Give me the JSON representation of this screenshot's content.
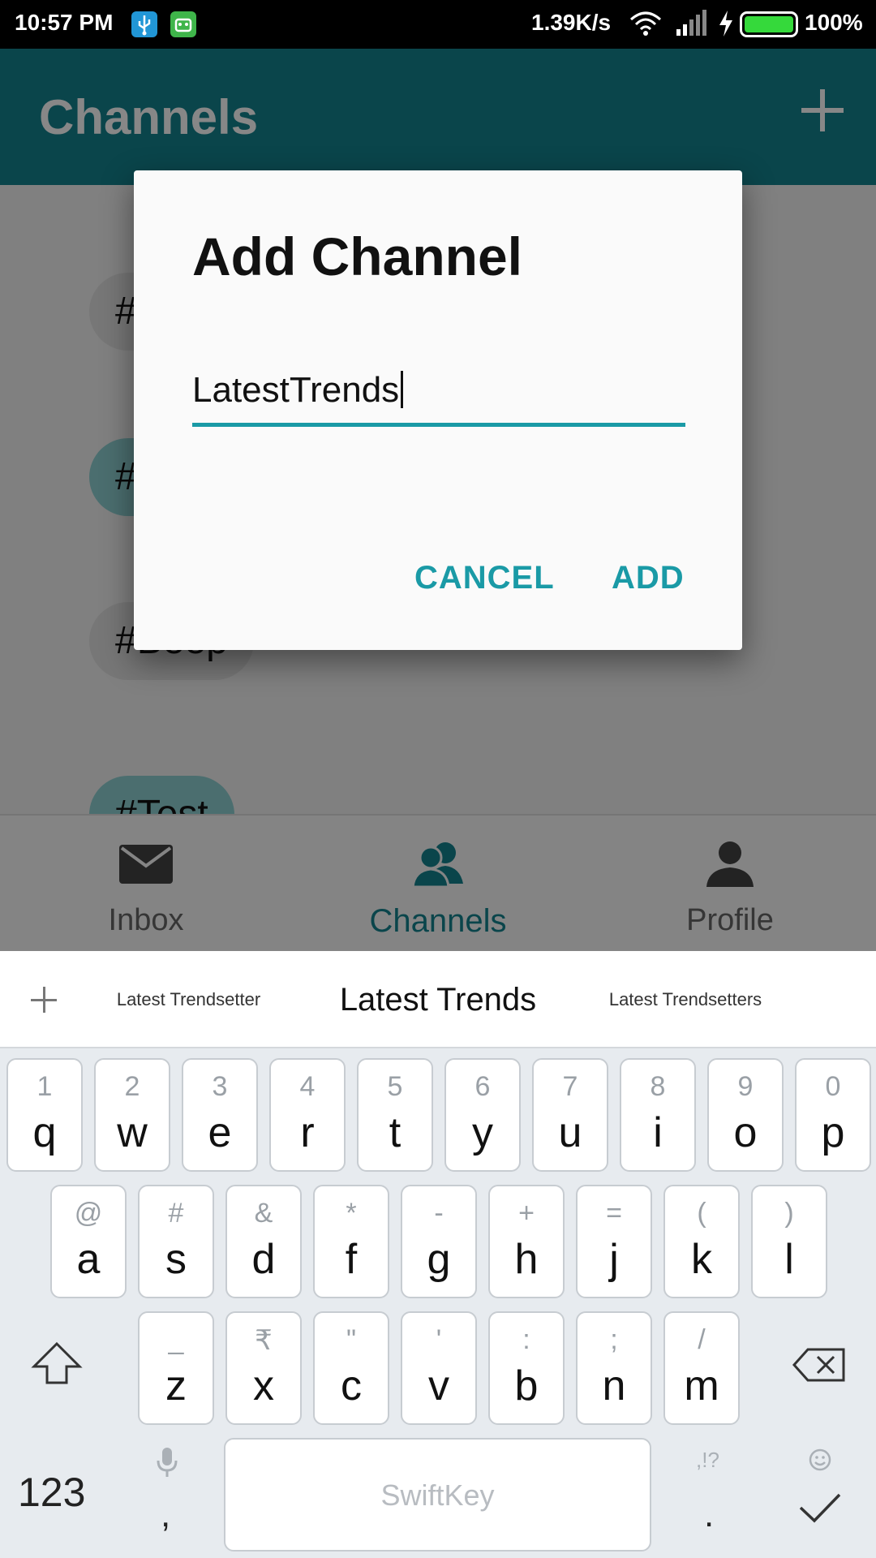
{
  "status_bar": {
    "time": "10:57 PM",
    "net_speed": "1.39K/s",
    "battery_level": "100%",
    "icons": [
      "usb-icon",
      "robot-icon",
      "wifi-icon",
      "signal-icon",
      "charging-icon",
      "battery-icon"
    ]
  },
  "toolbar": {
    "title": "Channels",
    "add_icon": "plus-icon"
  },
  "channels": {
    "items": [
      {
        "label": "#",
        "style": "grey"
      },
      {
        "label": "#",
        "style": "teal"
      },
      {
        "label": "#Beep",
        "style": "grey"
      },
      {
        "label": "#Test",
        "style": "teal"
      }
    ]
  },
  "bottom_nav": {
    "items": [
      {
        "label": "Inbox",
        "icon": "mail-icon",
        "active": false
      },
      {
        "label": "Channels",
        "icon": "people-icon",
        "active": true
      },
      {
        "label": "Profile",
        "icon": "person-icon",
        "active": false
      }
    ]
  },
  "dialog": {
    "title": "Add Channel",
    "input_value": "LatestTrends",
    "cancel_label": "CANCEL",
    "add_label": "ADD"
  },
  "keyboard": {
    "suggestions": [
      "Latest Trendsetter",
      "Latest Trends",
      "Latest Trendsetters"
    ],
    "row1": [
      {
        "main": "q",
        "hint": "1"
      },
      {
        "main": "w",
        "hint": "2"
      },
      {
        "main": "e",
        "hint": "3"
      },
      {
        "main": "r",
        "hint": "4"
      },
      {
        "main": "t",
        "hint": "5"
      },
      {
        "main": "y",
        "hint": "6"
      },
      {
        "main": "u",
        "hint": "7"
      },
      {
        "main": "i",
        "hint": "8"
      },
      {
        "main": "o",
        "hint": "9"
      },
      {
        "main": "p",
        "hint": "0"
      }
    ],
    "row2": [
      {
        "main": "a",
        "hint": "@"
      },
      {
        "main": "s",
        "hint": "#"
      },
      {
        "main": "d",
        "hint": "&"
      },
      {
        "main": "f",
        "hint": "*"
      },
      {
        "main": "g",
        "hint": "-"
      },
      {
        "main": "h",
        "hint": "+"
      },
      {
        "main": "j",
        "hint": "="
      },
      {
        "main": "k",
        "hint": "("
      },
      {
        "main": "l",
        "hint": ")"
      }
    ],
    "row3": [
      {
        "main": "z",
        "hint": "_"
      },
      {
        "main": "x",
        "hint": "₹"
      },
      {
        "main": "c",
        "hint": "\""
      },
      {
        "main": "v",
        "hint": "'"
      },
      {
        "main": "b",
        "hint": ":"
      },
      {
        "main": "n",
        "hint": ";"
      },
      {
        "main": "m",
        "hint": "/"
      }
    ],
    "numbers_label": "123",
    "comma_label": ",",
    "period_label": ".",
    "period_hint": ",!?",
    "space_label": "SwiftKey",
    "colors": {
      "accent": "#14838f",
      "key_bg": "#ffffff",
      "board_bg": "#e7ebef"
    }
  }
}
